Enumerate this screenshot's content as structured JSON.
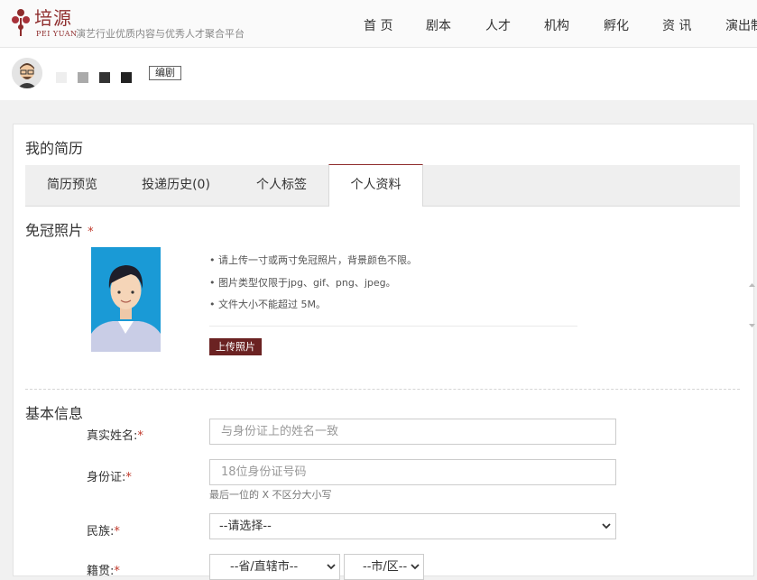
{
  "header": {
    "logo_cn": "培源",
    "logo_en": "PEI YUAN",
    "slogan": "演艺行业优质内容与优秀人才聚合平台",
    "nav": [
      "首 页",
      "剧本",
      "人才",
      "机构",
      "孵化",
      "资 讯",
      "演出制"
    ]
  },
  "user": {
    "edit_label": "编剧",
    "pixel_blocks": [
      "#eeeeee",
      "#aaaaaa",
      "#333333",
      "#222222"
    ]
  },
  "card": {
    "title": "我的简历",
    "tabs": [
      "简历预览",
      "投递历史(0)",
      "个人标签",
      "个人资料"
    ],
    "active_tab": "个人资料"
  },
  "photo_section": {
    "title": "免冠照片",
    "required_mark": "*",
    "tips": [
      "• 请上传一寸或两寸免冠照片，背景颜色不限。",
      "• 图片类型仅限于jpg、gif、png、jpeg。",
      "• 文件大小不能超过 5M。"
    ],
    "upload_label": "上传照片"
  },
  "basic_info": {
    "title": "基本信息",
    "name_label": "真实姓名:",
    "name_placeholder": "与身份证上的姓名一致",
    "id_label": "身份证:",
    "id_placeholder": "18位身份证号码",
    "id_hint": "最后一位的 X 不区分大小写",
    "ethnicity_label": "民族:",
    "ethnicity_value": "--请选择--",
    "native_label": "籍贯:",
    "native_province": "--省/直辖市--",
    "native_district": "--市/区--",
    "required_mark": "*"
  },
  "colors": {
    "brand": "#8e2c2c",
    "upload_button": "#6b2222",
    "photo_background": "#1a9ad6"
  }
}
